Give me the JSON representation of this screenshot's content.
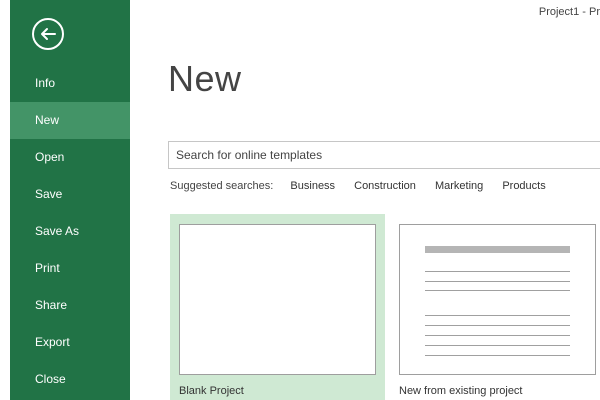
{
  "window": {
    "title": "Project1 - Pr"
  },
  "backstage": {
    "accent_color": "#217346",
    "active_color": "#439467",
    "back_icon": "back-arrow-icon",
    "items": [
      {
        "label": "Info"
      },
      {
        "label": "New"
      },
      {
        "label": "Open"
      },
      {
        "label": "Save"
      },
      {
        "label": "Save As"
      },
      {
        "label": "Print"
      },
      {
        "label": "Share"
      },
      {
        "label": "Export"
      },
      {
        "label": "Close"
      }
    ],
    "active_item": "New"
  },
  "main": {
    "title": "New",
    "search": {
      "placeholder": "Search for online templates",
      "value": ""
    },
    "suggested": {
      "label": "Suggested searches:",
      "links": [
        "Business",
        "Construction",
        "Marketing",
        "Products"
      ]
    },
    "templates": [
      {
        "caption": "Blank Project",
        "selected": true
      },
      {
        "caption": "New from existing project",
        "selected": false
      }
    ]
  }
}
